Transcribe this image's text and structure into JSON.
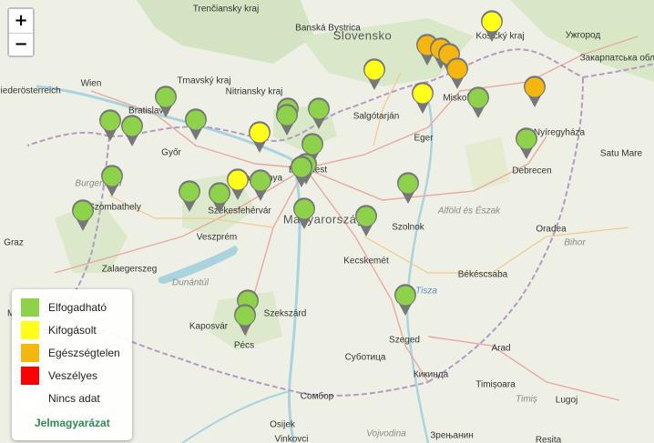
{
  "zoom": {
    "in_label": "+",
    "out_label": "−"
  },
  "colors": {
    "good": "#8ed14b",
    "moderate": "#ffff1a",
    "unhealthy": "#f5b70f",
    "dangerous": "#ff0000",
    "nodata": "#ffffff",
    "marker_ring": "#777777",
    "legend_link": "#2e8b57"
  },
  "legend": {
    "items": [
      {
        "label": "Elfogadható",
        "color": "#8ed14b"
      },
      {
        "label": "Kifogásolt",
        "color": "#ffff1a"
      },
      {
        "label": "Egészségtelen",
        "color": "#f5b70f"
      },
      {
        "label": "Veszélyes",
        "color": "#ff0000"
      },
      {
        "label": "Nincs adat",
        "color": "#ffffff"
      }
    ],
    "title_link": "Jelmagyarázat"
  },
  "map_labels": {
    "countries": [
      "Slovensko",
      "Magyarország"
    ],
    "cities": [
      "Trenčiansky kraj",
      "Banská Bystrica",
      "Košický kraj",
      "Ужгород",
      "Закарпатська область",
      "Niederösterreich",
      "Wien",
      "Bratislava",
      "Trnavský kraj",
      "Nitriansky kraj",
      "Salgótarján",
      "Miskolc",
      "Eger",
      "Nyíregyháza",
      "Budapest",
      "Tatabánya",
      "Győr",
      "Szombathely",
      "Székesfehérvár",
      "Veszprém",
      "Debrecen",
      "Szolnok",
      "Kecskemét",
      "Oradea",
      "Graz",
      "Zalaegerszeg",
      "Maribor",
      "Kaposvár",
      "Szekszárd",
      "Pécs",
      "Szeged",
      "Békéscsaba",
      "Arad",
      "Timișoara",
      "Lugoj",
      "Суботица",
      "Кикинда",
      "Сомбор",
      "Osijek",
      "Vinkovci",
      "Зрењанин",
      "Resita",
      "Satu Mare"
    ],
    "regions": [
      "Alföld és Észak",
      "Dunántúl",
      "Burgenland",
      "Bihor",
      "Timiș",
      "Vojvodina"
    ],
    "water": [
      "Tisza"
    ]
  },
  "stations": [
    {
      "status": "good"
    },
    {
      "status": "good"
    },
    {
      "status": "good"
    },
    {
      "status": "good"
    },
    {
      "status": "good"
    },
    {
      "status": "good"
    },
    {
      "status": "good"
    },
    {
      "status": "good"
    },
    {
      "status": "good"
    },
    {
      "status": "good"
    },
    {
      "status": "good"
    },
    {
      "status": "good"
    },
    {
      "status": "good"
    },
    {
      "status": "good"
    },
    {
      "status": "good"
    },
    {
      "status": "good"
    },
    {
      "status": "good"
    },
    {
      "status": "good"
    },
    {
      "status": "good"
    },
    {
      "status": "good"
    },
    {
      "status": "good"
    },
    {
      "status": "good"
    },
    {
      "status": "good"
    },
    {
      "status": "good"
    },
    {
      "status": "moderate"
    },
    {
      "status": "moderate"
    },
    {
      "status": "moderate"
    },
    {
      "status": "moderate"
    },
    {
      "status": "moderate"
    },
    {
      "status": "unhealthy"
    },
    {
      "status": "unhealthy"
    },
    {
      "status": "unhealthy"
    },
    {
      "status": "unhealthy"
    },
    {
      "status": "unhealthy"
    }
  ]
}
